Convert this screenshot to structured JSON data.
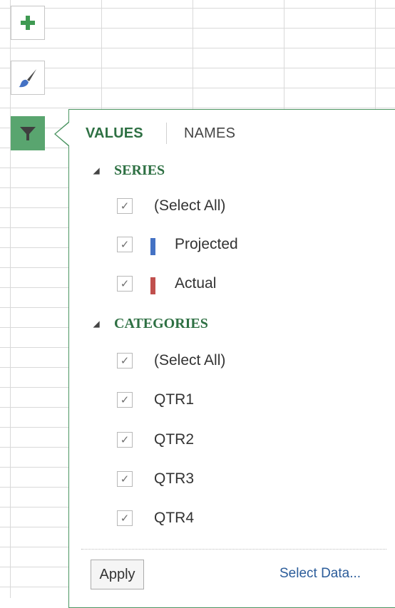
{
  "tabs": {
    "values_label": "VALUES",
    "names_label": "NAMES"
  },
  "series": {
    "heading": "SERIES",
    "items": [
      {
        "label": "(Select All)",
        "checked": true
      },
      {
        "label": "Projected",
        "checked": true,
        "color": "#4472c4"
      },
      {
        "label": "Actual",
        "checked": true,
        "color": "#c0504d"
      }
    ]
  },
  "categories": {
    "heading": "CATEGORIES",
    "items": [
      {
        "label": "(Select All)",
        "checked": true
      },
      {
        "label": "QTR1",
        "checked": true
      },
      {
        "label": "QTR2",
        "checked": true
      },
      {
        "label": "QTR3",
        "checked": true
      },
      {
        "label": "QTR4",
        "checked": true
      }
    ]
  },
  "footer": {
    "apply_label": "Apply",
    "select_data_label": "Select Data..."
  },
  "icons": {
    "add": "plus-icon",
    "style": "paintbrush-icon",
    "filter": "funnel-icon",
    "collapse": "triangle-collapse-icon",
    "check": "checkmark-icon"
  },
  "colors": {
    "accent_green": "#2e7043",
    "filter_active": "#59a56f",
    "link": "#2b5c9a"
  }
}
